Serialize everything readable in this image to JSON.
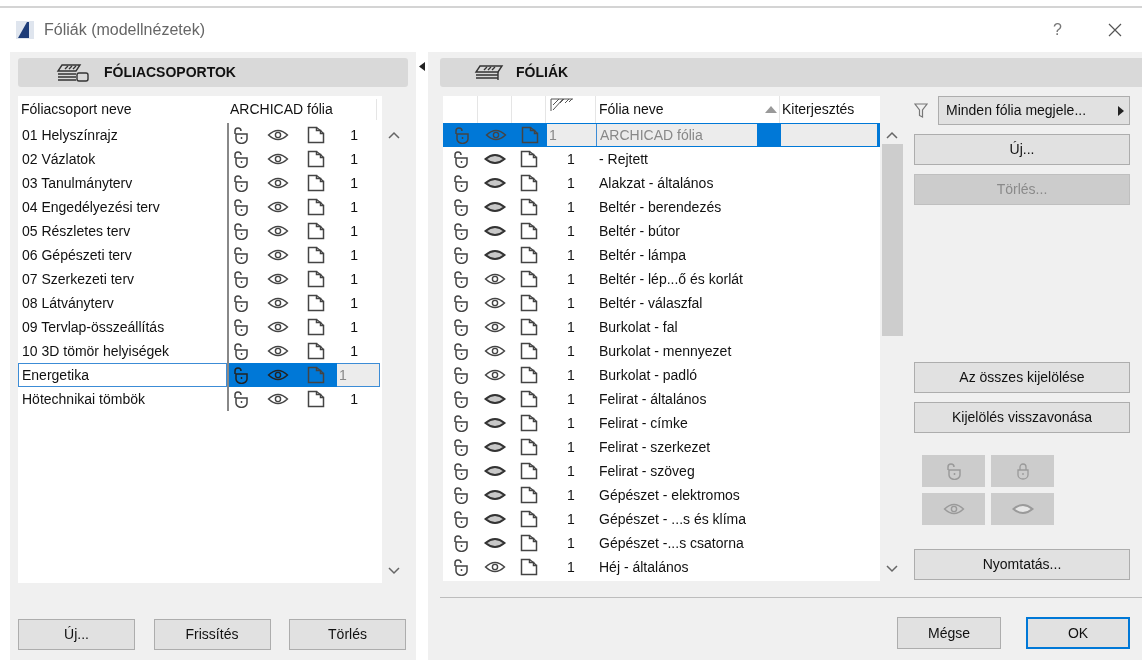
{
  "window": {
    "title": "Fóliák (modellnézetek)",
    "help": "?"
  },
  "groups_panel": {
    "title": "FÓLIACSOPORTOK",
    "columns": [
      "Fóliacsoport neve",
      "ARCHICAD fólia"
    ],
    "rows": [
      {
        "name": "01 Helyszínrajz",
        "count": "1",
        "selected": false
      },
      {
        "name": "02 Vázlatok",
        "count": "1",
        "selected": false
      },
      {
        "name": "03 Tanulmányterv",
        "count": "1",
        "selected": false
      },
      {
        "name": "04 Engedélyezési terv",
        "count": "1",
        "selected": false
      },
      {
        "name": "05 Részletes terv",
        "count": "1",
        "selected": false
      },
      {
        "name": "06 Gépészeti terv",
        "count": "1",
        "selected": false
      },
      {
        "name": "07 Szerkezeti terv",
        "count": "1",
        "selected": false
      },
      {
        "name": "08 Látványterv",
        "count": "1",
        "selected": false
      },
      {
        "name": "09 Tervlap-összeállítás",
        "count": "1",
        "selected": false
      },
      {
        "name": "10 3D tömör helyiségek",
        "count": "1",
        "selected": false
      },
      {
        "name": "Energetika",
        "count": "1",
        "selected": true
      },
      {
        "name": "Hötechnikai tömbök",
        "count": "1",
        "selected": false
      }
    ],
    "buttons": [
      "Új...",
      "Frissítés",
      "Törlés"
    ]
  },
  "layers_panel": {
    "title": "FÓLIÁK",
    "columns": [
      "Fólia neve",
      "Kiterjesztés"
    ],
    "rows": [
      {
        "name": "ARCHICAD fólia",
        "number": "1",
        "visible": true,
        "selected": true
      },
      {
        "name": "- Rejtett",
        "number": "1",
        "visible": false,
        "selected": false
      },
      {
        "name": "Alakzat - általános",
        "number": "1",
        "visible": false,
        "selected": false
      },
      {
        "name": "Beltér - berendezés",
        "number": "1",
        "visible": false,
        "selected": false
      },
      {
        "name": "Beltér - bútor",
        "number": "1",
        "visible": false,
        "selected": false
      },
      {
        "name": "Beltér - lámpa",
        "number": "1",
        "visible": false,
        "selected": false
      },
      {
        "name": "Beltér - lép...ő és korlát",
        "number": "1",
        "visible": true,
        "selected": false
      },
      {
        "name": "Beltér - válaszfal",
        "number": "1",
        "visible": true,
        "selected": false
      },
      {
        "name": "Burkolat - fal",
        "number": "1",
        "visible": true,
        "selected": false
      },
      {
        "name": "Burkolat - mennyezet",
        "number": "1",
        "visible": true,
        "selected": false
      },
      {
        "name": "Burkolat - padló",
        "number": "1",
        "visible": true,
        "selected": false
      },
      {
        "name": "Felirat - általános",
        "number": "1",
        "visible": false,
        "selected": false
      },
      {
        "name": "Felirat - címke",
        "number": "1",
        "visible": false,
        "selected": false
      },
      {
        "name": "Felirat - szerkezet",
        "number": "1",
        "visible": false,
        "selected": false
      },
      {
        "name": "Felirat - szöveg",
        "number": "1",
        "visible": false,
        "selected": false
      },
      {
        "name": "Gépészet - elektromos",
        "number": "1",
        "visible": false,
        "selected": false
      },
      {
        "name": "Gépészet - ...s és klíma",
        "number": "1",
        "visible": false,
        "selected": false
      },
      {
        "name": "Gépészet -...s csatorna",
        "number": "1",
        "visible": false,
        "selected": false
      },
      {
        "name": "Héj - általános",
        "number": "1",
        "visible": true,
        "selected": false
      }
    ],
    "filter": "Minden fólia megjele...",
    "buttons": [
      {
        "label": "Új...",
        "disabled": false
      },
      {
        "label": "Törlés...",
        "disabled": true
      }
    ],
    "selection_buttons": [
      "Az összes kijelölése",
      "Kijelölés visszavonása"
    ],
    "print_button": "Nyomtatás..."
  },
  "footer_buttons": [
    {
      "label": "Mégse",
      "default": false
    },
    {
      "label": "OK",
      "default": true
    }
  ]
}
